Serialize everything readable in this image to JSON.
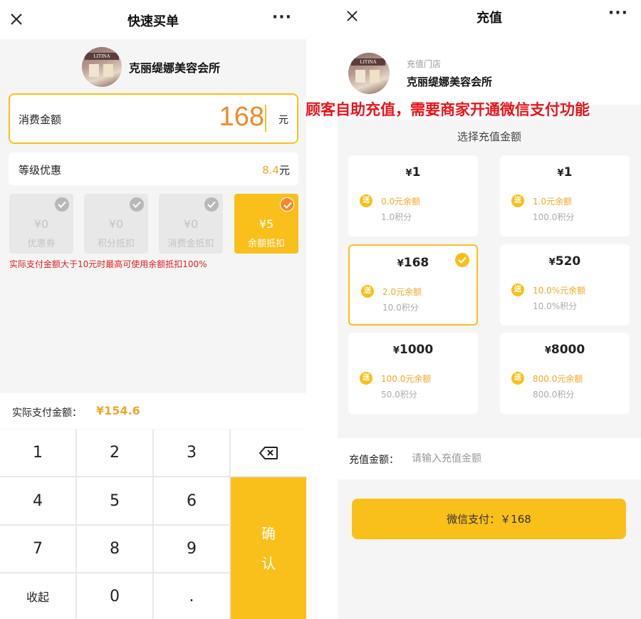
{
  "left": {
    "nav": {
      "title": "快速买单",
      "more": "···"
    },
    "shop": {
      "sign": "LITINA",
      "name": "克丽缇娜美容会所"
    },
    "amount": {
      "label": "消费金额",
      "value": "168",
      "unit": "元"
    },
    "level": {
      "label": "等级优惠",
      "value": "8.4",
      "unit": "元"
    },
    "discounts": [
      {
        "amount": "¥0",
        "label": "优惠券",
        "active": false
      },
      {
        "amount": "¥0",
        "label": "积分抵扣",
        "active": false
      },
      {
        "amount": "¥0",
        "label": "消费金抵扣",
        "active": false
      },
      {
        "amount": "¥5",
        "label": "余额抵扣",
        "active": true
      }
    ],
    "hint": "实际支付金额大于10元时最高可使用余额抵扣100%",
    "pay": {
      "label": "实际支付金额：",
      "value": "¥154.6"
    },
    "keypad": {
      "k1": "1",
      "k2": "2",
      "k3": "3",
      "k4": "4",
      "k5": "5",
      "k6": "6",
      "k7": "7",
      "k8": "8",
      "k9": "9",
      "collapse": "收起",
      "k0": "0",
      "dot": ".",
      "confirm_line1": "确",
      "confirm_line2": "认",
      "backspace_icon": "backspace-icon"
    }
  },
  "right": {
    "nav": {
      "title": "充值",
      "more": "···"
    },
    "store": {
      "label": "充值门店",
      "name": "克丽缇娜美容会所",
      "sign": "LITINA"
    },
    "options_heading": "选择充值金额",
    "options": [
      {
        "yen": "¥",
        "price": "1",
        "badge": "送",
        "bonus": "0.0元余额",
        "points": "1.0积分",
        "selected": false
      },
      {
        "yen": "¥",
        "price": "1",
        "badge": "送",
        "bonus": "1.0元余额",
        "points": "100.0积分",
        "selected": false
      },
      {
        "yen": "¥",
        "price": "168",
        "badge": "送",
        "bonus": "2.0元余额",
        "points": "10.0积分",
        "selected": true
      },
      {
        "yen": "¥",
        "price": "520",
        "badge": "送",
        "bonus": "10.0%元余额",
        "points": "10.0%积分",
        "selected": false
      },
      {
        "yen": "¥",
        "price": "1000",
        "badge": "送",
        "bonus": "100.0元余额",
        "points": "50.0积分",
        "selected": false
      },
      {
        "yen": "¥",
        "price": "8000",
        "badge": "送",
        "bonus": "800.0元余额",
        "points": "800.0积分",
        "selected": false
      }
    ],
    "input": {
      "label": "充值金额：",
      "placeholder": "请输入充值金额",
      "value": ""
    },
    "pay_button": "微信支付：￥168"
  },
  "caption": "顾客自助充值，需要商家开通微信支付功能",
  "colors": {
    "accent": "#f9c01c",
    "orange": "#f0892a",
    "hint_red": "#e02020",
    "caption_red": "#e8141a"
  }
}
